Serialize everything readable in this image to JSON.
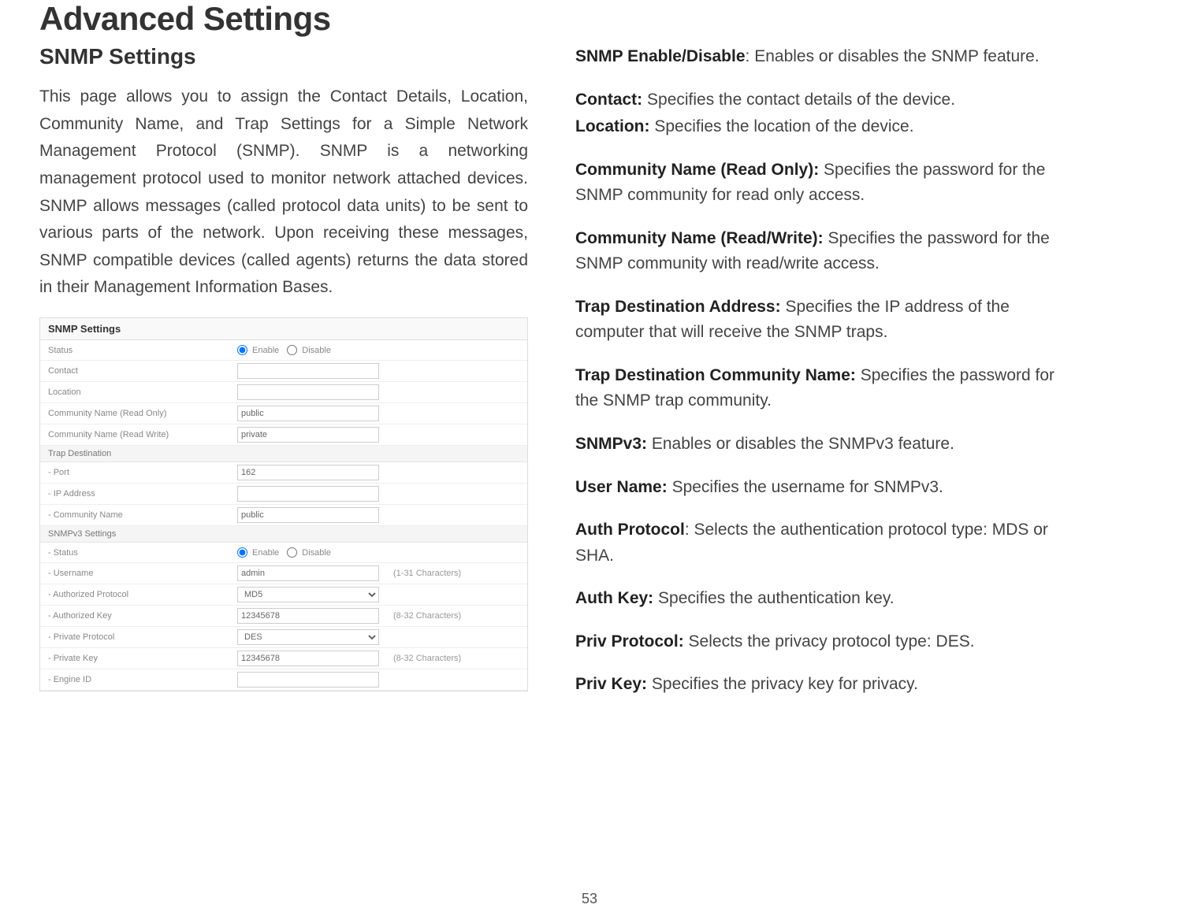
{
  "page_title": "Advanced Settings",
  "page_number": "53",
  "left": {
    "section_title": "SNMP Settings",
    "intro": "This page allows you to assign the Contact Details, Location, Community Name, and Trap Settings for a Simple Network Management Protocol (SNMP). SNMP is a networking management protocol used to monitor network attached devices. SNMP allows messages (called protocol data units) to be sent to various parts of the network. Upon receiving these messages, SNMP compatible devices (called agents) returns the data stored in their Management Information Bases."
  },
  "snmp": {
    "header": "SNMP Settings",
    "trap_header": "Trap Destination",
    "v3_header": "SNMPv3 Settings",
    "rows": {
      "status_label": "Status",
      "enable_label": "Enable",
      "disable_label": "Disable",
      "contact_label": "Contact",
      "contact_value": "",
      "location_label": "Location",
      "location_value": "",
      "comm_ro_label": "Community Name (Read Only)",
      "comm_ro_value": "public",
      "comm_rw_label": "Community Name (Read Write)",
      "comm_rw_value": "private",
      "port_label": "- Port",
      "port_value": "162",
      "ip_label": "- IP Address",
      "ip_value": "",
      "t_comm_label": "- Community Name",
      "t_comm_value": "public",
      "v3_status_label": "- Status",
      "v3_user_label": "- Username",
      "v3_user_value": "admin",
      "v3_user_hint": "(1-31 Characters)",
      "v3_authp_label": "- Authorized Protocol",
      "v3_authp_value": "MD5",
      "v3_authk_label": "- Authorized Key",
      "v3_authk_value": "12345678",
      "v3_authk_hint": "(8-32 Characters)",
      "v3_privp_label": "- Private Protocol",
      "v3_privp_value": "DES",
      "v3_privk_label": "- Private Key",
      "v3_privk_value": "12345678",
      "v3_privk_hint": "(8-32 Characters)",
      "v3_engine_label": "- Engine ID",
      "v3_engine_value": ""
    }
  },
  "right": {
    "defs": {
      "enable_t": "SNMP Enable/Disable",
      "enable_d": ": Enables or disables the SNMP feature.",
      "contact_t": "Contact:",
      "contact_d": " Specifies the contact details of the device.",
      "location_t": "Location:",
      "location_d": " Specifies the location of the device.",
      "comm_ro_t": "Community Name (Read Only):",
      "comm_ro_d": " Specifies the password for the SNMP community for read only access.",
      "comm_rw_t": "Community Name (Read/Write):",
      "comm_rw_d": " Specifies the password for the SNMP community with read/write access.",
      "tda_t": "Trap Destination Address:",
      "tda_d": " Specifies the IP address of the computer that will receive the SNMP traps.",
      "tdcn_t": "Trap Destination Community Name:",
      "tdcn_d": " Specifies the password for the SNMP trap community.",
      "v3_t": "SNMPv3:",
      "v3_d": " Enables or disables the SNMPv3 feature.",
      "user_t": "User Name:",
      "user_d": " Specifies the username for SNMPv3.",
      "authp_t": "Auth Protocol",
      "authp_d": ": Selects the authentication protocol type: MDS or SHA.",
      "authk_t": "Auth Key:",
      "authk_d": " Specifies the authentication key.",
      "privp_t": "Priv Protocol:",
      "privp_d": " Selects the privacy protocol type: DES.",
      "privk_t": "Priv Key:",
      "privk_d": " Specifies the privacy key for privacy."
    }
  }
}
